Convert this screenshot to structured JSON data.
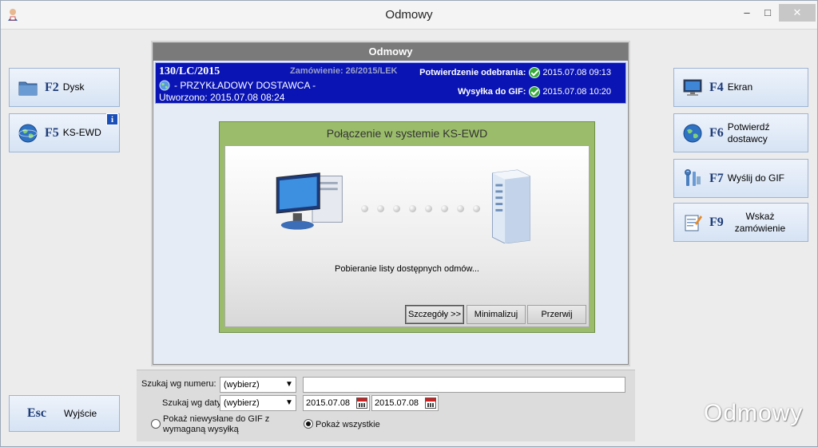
{
  "window": {
    "title": "Odmowy",
    "minimize": "–",
    "maximize": "□",
    "close": "✕"
  },
  "left_buttons": [
    {
      "key": "F2",
      "label": "Dysk",
      "icon": "folder-icon"
    },
    {
      "key": "F5",
      "label": "KS-EWD",
      "icon": "globe-icon",
      "badge": "i"
    },
    {
      "key": "Esc",
      "label": "Wyjście"
    }
  ],
  "right_buttons": [
    {
      "key": "F4",
      "label": "Ekran",
      "icon": "monitor-icon"
    },
    {
      "key": "F6",
      "label1": "Potwierdź",
      "label2": "dostawcy",
      "icon": "globe-icon"
    },
    {
      "key": "F7",
      "label": "Wyślij do GIF",
      "icon": "tools-icon"
    },
    {
      "key": "F9",
      "label1": "Wskaż",
      "label2": "zamówienie",
      "icon": "order-icon"
    }
  ],
  "panel": {
    "header": "Odmowy",
    "order_number": "130/LC/2015",
    "order_ref": "Zamówienie: 26/2015/LEK",
    "supplier": "- PRZYKŁADOWY DOSTAWCA -",
    "created": "Utworzono: 2015.07.08 08:24",
    "confirm_label": "Potwierdzenie odebrania:",
    "confirm_time": "2015.07.08 09:13",
    "gif_label": "Wysyłka do GIF:",
    "gif_time": "2015.07.08 10:20"
  },
  "dialog": {
    "title": "Połączenie w systemie KS-EWD",
    "message": "Pobieranie listy dostępnych odmów...",
    "details_button": "Szczegóły >>",
    "minimize_button": "Minimalizuj",
    "abort_button": "Przerwij"
  },
  "search": {
    "by_number_label": "Szukaj wg numeru:",
    "by_number_value": "(wybierz)",
    "by_date_label": "Szukaj wg daty:",
    "by_date_value": "(wybierz)",
    "date_from": "2015.07.08",
    "date_to": "2015.07.08",
    "radio_unsent_line1": "Pokaż niewysłane do GIF z",
    "radio_unsent_line2": "wymaganą wysyłką",
    "radio_all": "Pokaż wszystkie",
    "radio_all_selected": true
  },
  "watermark": "Odmowy",
  "colors": {
    "accent_blue": "#0a14b4",
    "dialog_green": "#9bbd6b",
    "check_green": "#36a83a"
  }
}
